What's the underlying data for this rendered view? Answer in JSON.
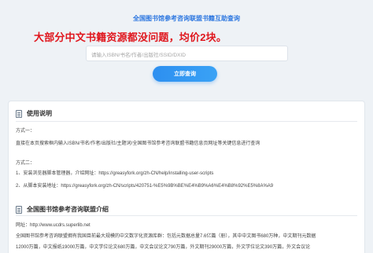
{
  "header": {
    "title": "全国图书馆参考咨询联盟书籍互助查询",
    "promo": "大部分中文书籍资源都没问题，均价2块。"
  },
  "search": {
    "placeholder": "请输入ISBN/书名/作者/出版社/SSID/DXID",
    "button_label": "立即查询"
  },
  "usage": {
    "heading": "使用说明",
    "method1_title": "方式一：",
    "method1_text": "直接在本页搜索框内输入ISBN/书名/作者/出版社/主题词/全国图书馆参考咨询联盟书籍信息页网址等关键信息进行查询",
    "method2_title": "方式二：",
    "step1_label": "1、安装浏览器脚本管理器，介绍网址：",
    "step1_url": "https://greasyfork.org/zh-CN/help/installing-user-scripts",
    "step2_label": "2、从脚本安装地址：",
    "step2_url": "https://greasyfork.org/zh-CN/scripts/420751-%E5%9B%BE%E4%B9%A6%E4%B8%92%E5%8A%A9"
  },
  "intro": {
    "heading": "全国图书馆参考咨询联盟介绍",
    "site_label": "网址：",
    "site_url": "http://www.ucdrs.superlib.net",
    "line1": "全国图书馆参考咨询联盟拥有我国目前最大规模的中文数字化资源库群：包括元数据总量7.6亿篇（册），其中中文图书680万种，中文期刊元数据",
    "line2": "12000万篇，中文报纸19000万篇，中文学位论文680万篇，中文会议论文790万篇，外文期刊29000万篇，外文学位论文390万篇，外文会议论"
  }
}
